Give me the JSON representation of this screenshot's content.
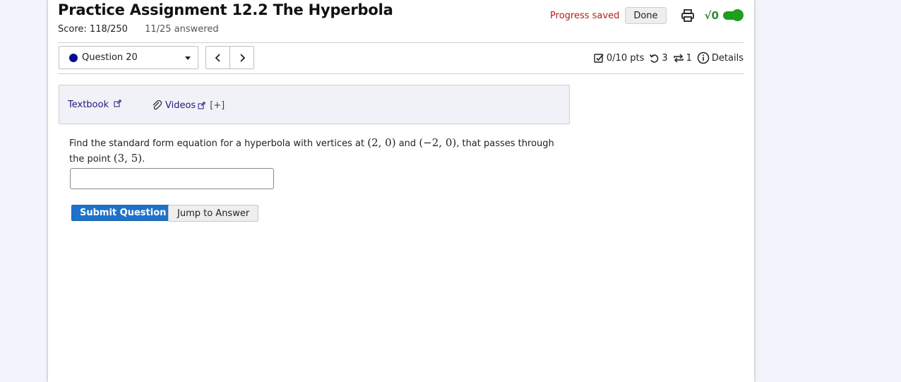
{
  "header": {
    "title": "Practice Assignment 12.2 The Hyperbola",
    "score": "Score: 118/250",
    "answered": "11/25 answered",
    "progress": "Progress saved",
    "done_label": "Done",
    "math_toggle_glyph": "√0",
    "toggle_on": true
  },
  "question_nav": {
    "selected": "Question 20",
    "prev_icon": "chevron-left-icon",
    "next_icon": "chevron-right-icon",
    "status_dot_color": "#0a0a8c"
  },
  "meta": {
    "points": "0/10 pts",
    "retries": "3",
    "attempts": "1",
    "details": "Details"
  },
  "resources": {
    "textbook": "Textbook",
    "videos": "Videos",
    "more": "[+]"
  },
  "question": {
    "text_1": "Find the standard form equation for a hyperbola with vertices at",
    "v1": "(2, 0)",
    "text_2": "and",
    "v2": "(−2, 0)",
    "text_3": ", that passes through the point",
    "point": "(3, 5)",
    "text_4": "."
  },
  "answer": {
    "value": "",
    "placeholder": ""
  },
  "buttons": {
    "submit": "Submit Question",
    "jump": "Jump to Answer"
  },
  "colors": {
    "accent": "#1f72c9",
    "progress": "#b01e1e",
    "toggle": "#1ea01e",
    "link": "#1c1c7a"
  }
}
